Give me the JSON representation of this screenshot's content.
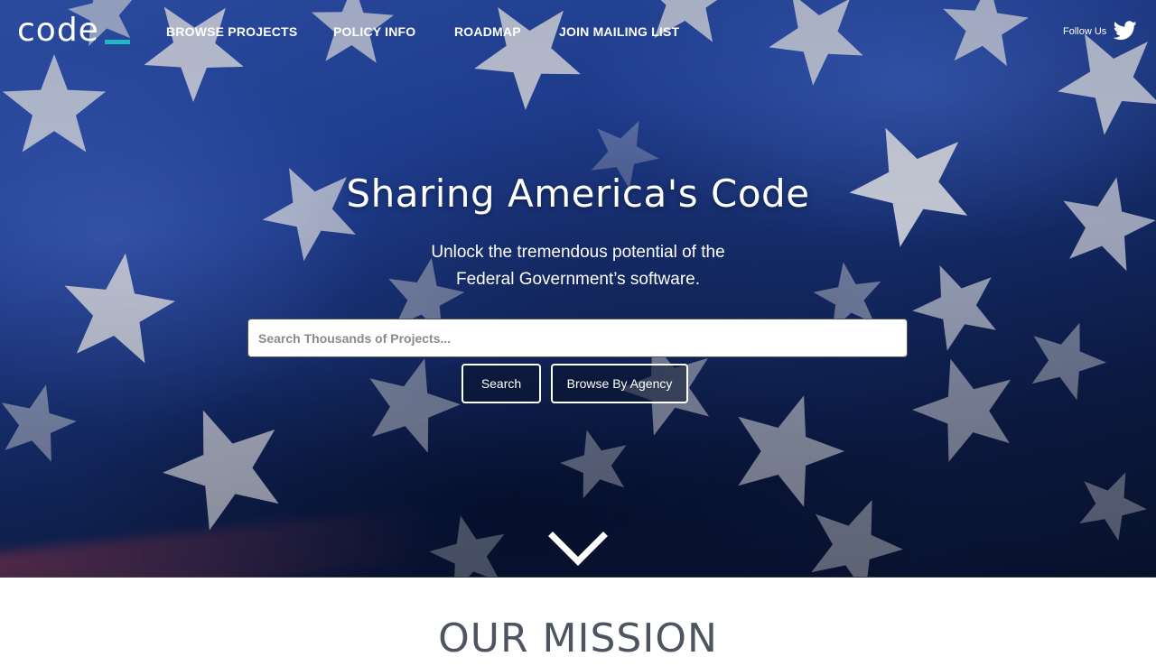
{
  "header": {
    "logo_text": "code",
    "accent_color": "#1fb8c4",
    "nav": [
      {
        "label": "BROWSE PROJECTS"
      },
      {
        "label": "POLICY INFO"
      },
      {
        "label": "ROADMAP"
      },
      {
        "label": "JOIN MAILING LIST"
      }
    ],
    "follow_label": "Follow Us",
    "social_icon": "twitter-icon"
  },
  "hero": {
    "title": "Sharing America's Code",
    "subtitle_line1": "Unlock the tremendous potential of the",
    "subtitle_line2": "Federal Government’s software.",
    "search_placeholder": "Search Thousands of Projects...",
    "search_value": "",
    "search_button": "Search",
    "agency_button": "Browse By Agency",
    "scroll_icon": "chevron-down-icon"
  },
  "mission": {
    "heading": "OUR MISSION"
  }
}
